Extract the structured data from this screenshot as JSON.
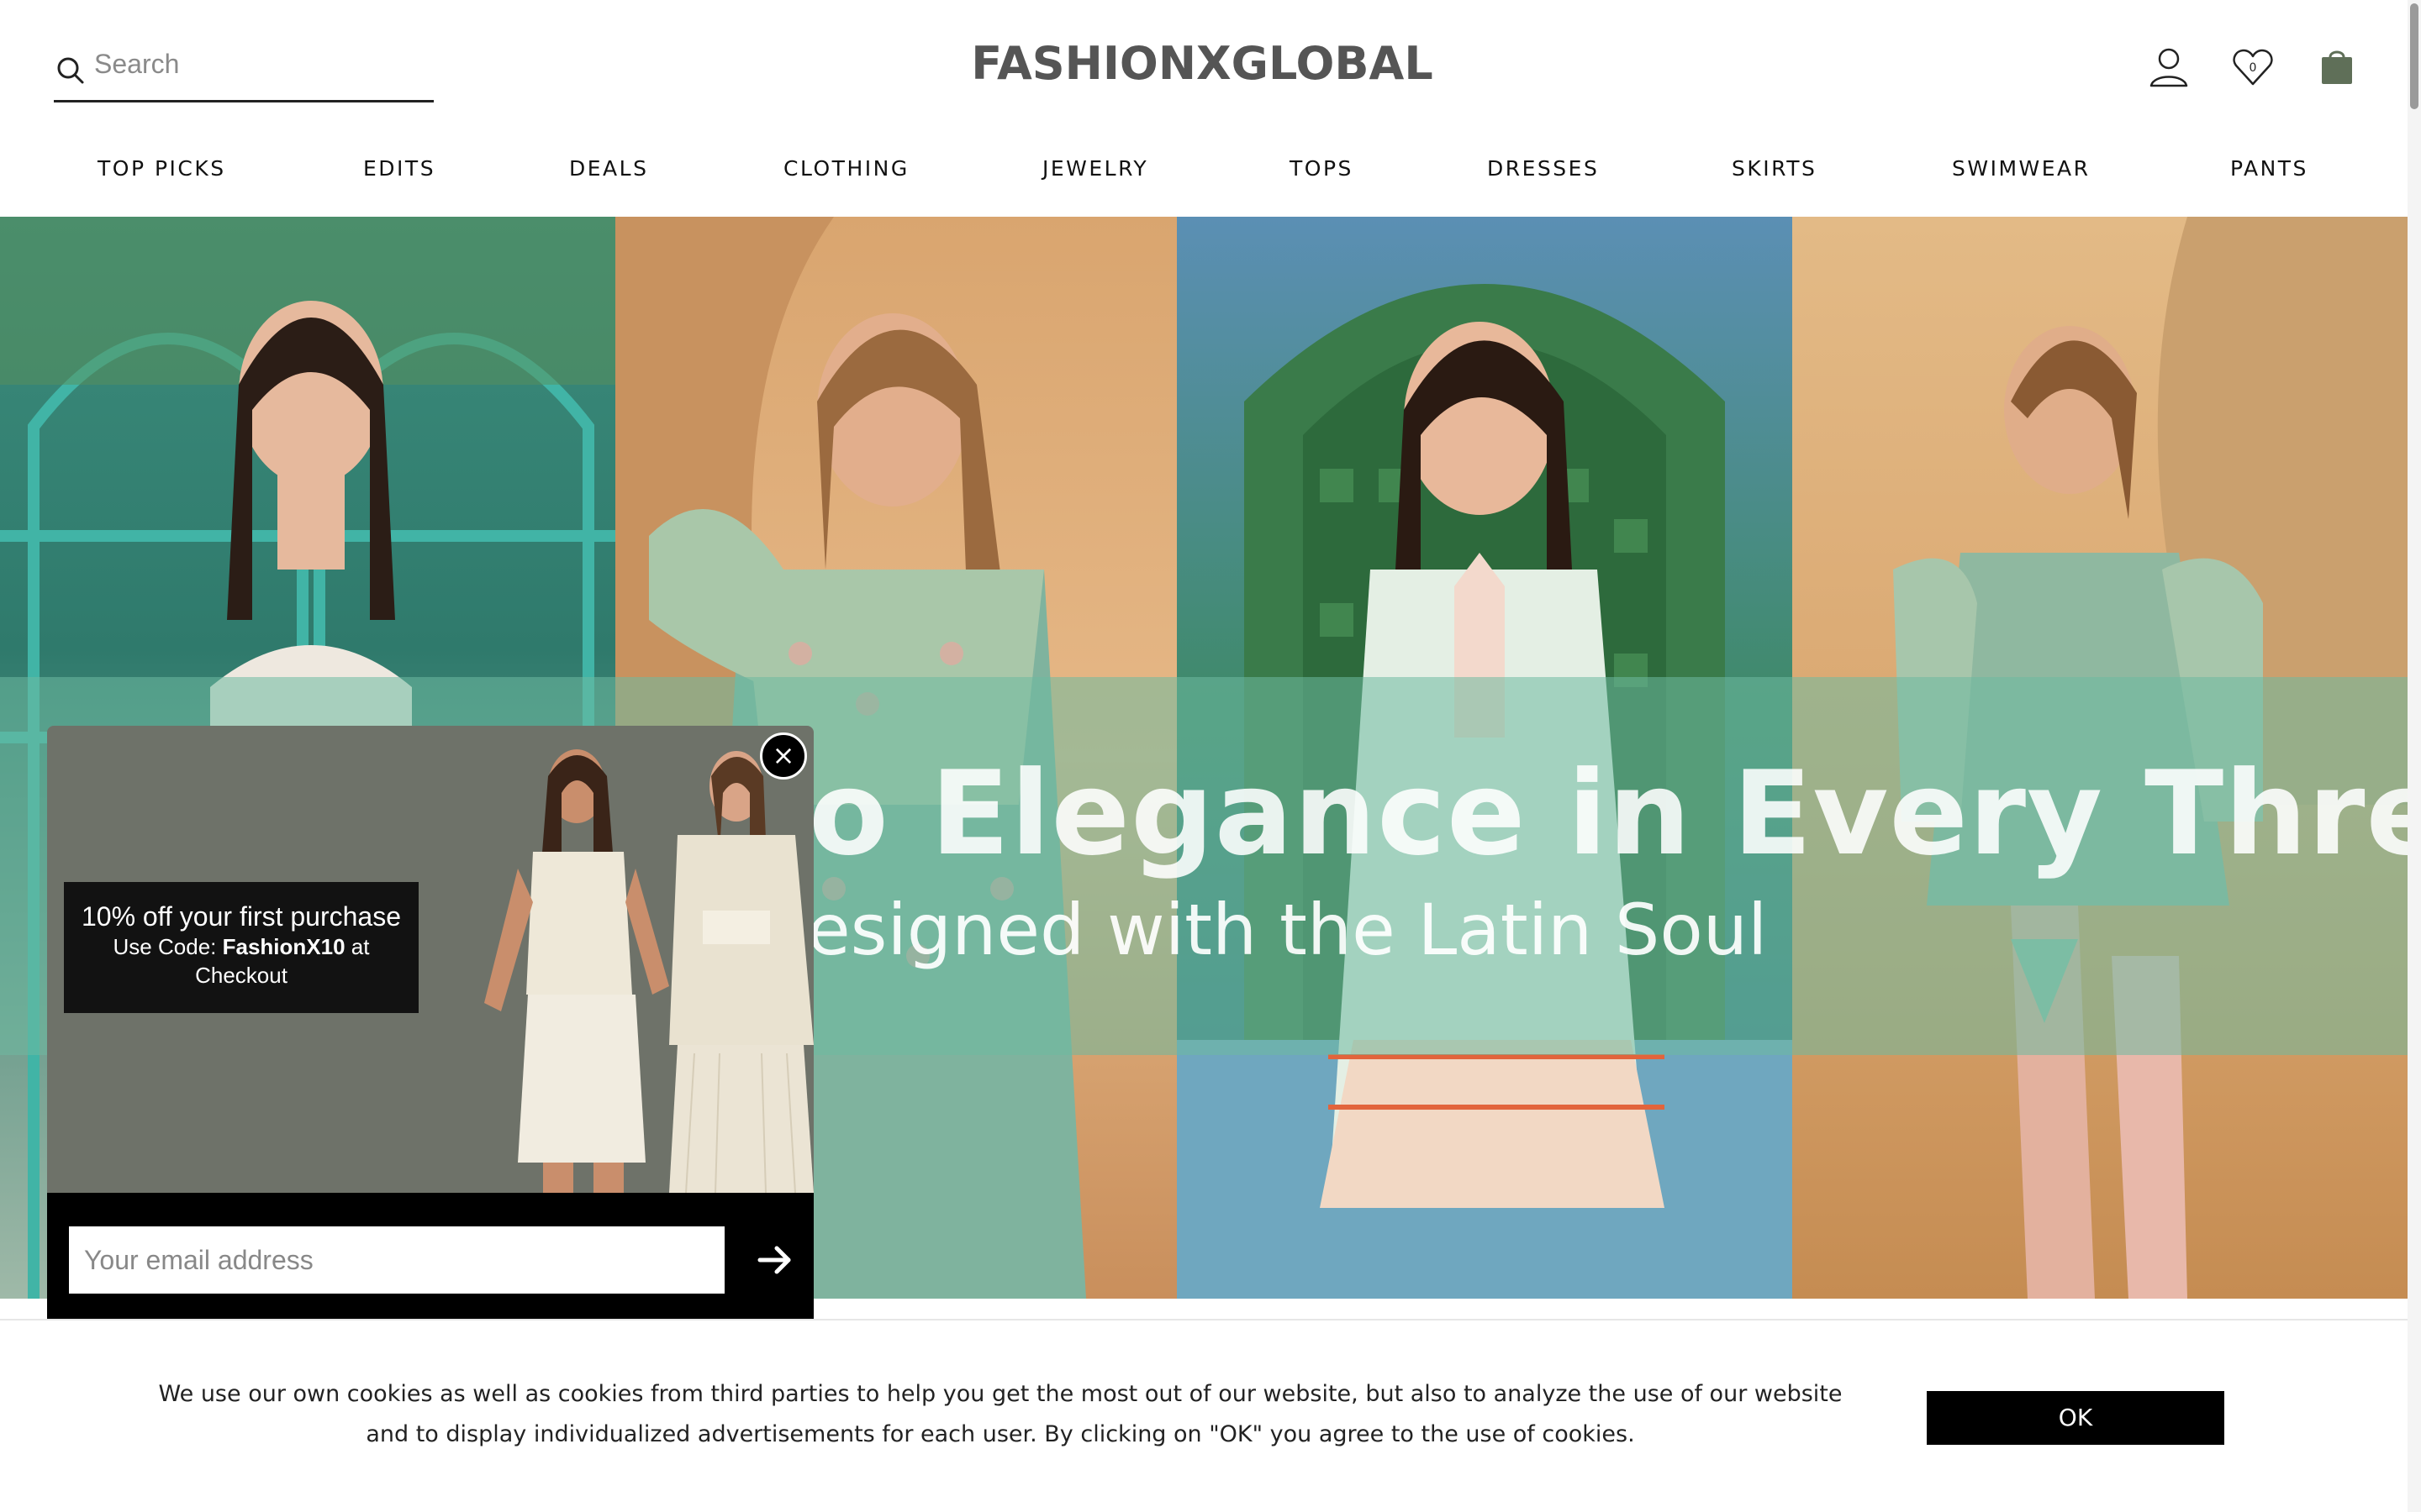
{
  "header": {
    "search_placeholder": "Search",
    "logo": "FASHIONXGLOBAL",
    "icons": [
      "search-icon",
      "account-icon",
      "wishlist-icon",
      "cart-icon"
    ],
    "wishlist_count": "0"
  },
  "nav": {
    "items": [
      "TOP PICKS",
      "EDITS",
      "DEALS",
      "CLOTHING",
      "JEWELRY",
      "TOPS",
      "DRESSES",
      "SKIRTS",
      "SWIMWEAR",
      "PANTS"
    ]
  },
  "hero": {
    "title": "o Elegance in Every Thread",
    "subtitle": "esigned with the Latin Soul"
  },
  "popup": {
    "promo_line1": "10% off your first purchase",
    "promo_line2_prefix": "Use Code: ",
    "promo_code": "FashionX10",
    "promo_line2_suffix": " at",
    "promo_line3": "Checkout",
    "close_label": "×",
    "email_placeholder": "Your email address"
  },
  "cookie": {
    "text": "We use our own cookies as well as cookies from third parties to help you get the most out of our website, but also to analyze the use of our website and to display individualized advertisements for each user. By clicking on \"OK\" you agree to the use of cookies.",
    "ok_label": "OK"
  },
  "colors": {
    "band": "#6eb9a0",
    "popup_bg": "#6e7269",
    "logo": "#555555"
  }
}
